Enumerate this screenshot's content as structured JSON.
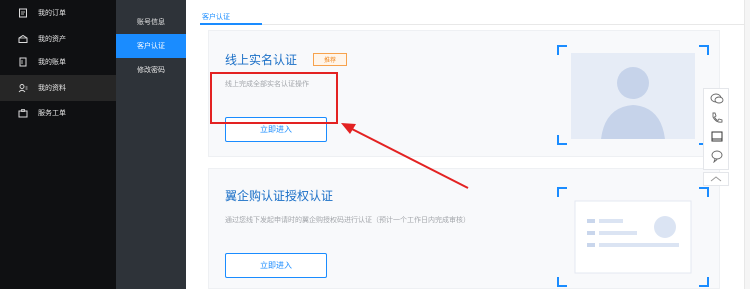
{
  "left_nav": {
    "items": [
      {
        "label": "我的订单",
        "icon": "order-icon"
      },
      {
        "label": "我的资产",
        "icon": "assets-icon"
      },
      {
        "label": "我的账单",
        "icon": "bill-icon"
      },
      {
        "label": "我的资料",
        "icon": "profile-icon"
      },
      {
        "label": "服务工单",
        "icon": "ticket-icon"
      }
    ],
    "active_index": 3
  },
  "sub_nav": {
    "items": [
      {
        "label": "账号信息"
      },
      {
        "label": "客户认证"
      },
      {
        "label": "修改密码"
      }
    ],
    "active_index": 1
  },
  "main": {
    "tab_label": "客户认证",
    "card1": {
      "title": "线上实名认证",
      "tag": "推荐",
      "desc": "线上完成全部实名认证操作",
      "button": "立即进入"
    },
    "card2": {
      "title": "翼企购认证授权认证",
      "desc": "通过您线下发起申请时的翼企购授权码进行认证（预计一个工作日内完成审核）",
      "button": "立即进入"
    }
  },
  "float_toolbar": {
    "icons": [
      "chat-icon",
      "phone-icon",
      "screen-icon",
      "feedback-icon"
    ],
    "top_icon": "back-to-top-icon"
  },
  "colors": {
    "accent": "#1a8cff",
    "highlight": "#e32222",
    "sidebar": "#0f1012",
    "subnav": "#2e3339"
  }
}
